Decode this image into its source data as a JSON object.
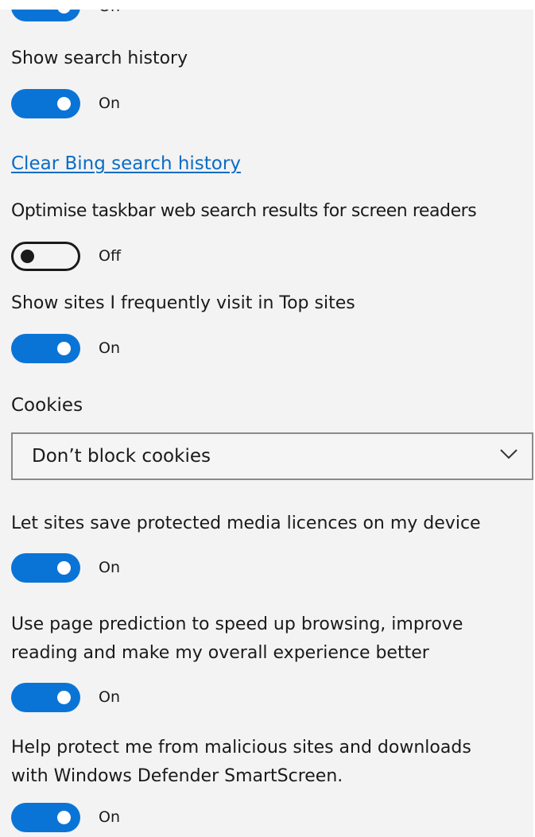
{
  "settings": {
    "top_partial_state": "On",
    "search_history": {
      "label": "Show search history",
      "state": "On",
      "enabled": true
    },
    "clear_bing_link": "Clear Bing search history",
    "taskbar_screen_readers": {
      "label": "Optimise taskbar web search results for screen readers",
      "state": "Off",
      "enabled": false
    },
    "top_sites": {
      "label": "Show sites I frequently visit in Top sites",
      "state": "On",
      "enabled": true
    },
    "cookies": {
      "label": "Cookies",
      "selected": "Don’t block cookies"
    },
    "media_licences": {
      "label": "Let sites save protected media licences on my device",
      "state": "On",
      "enabled": true
    },
    "page_prediction": {
      "label_line1": "Use page prediction to speed up browsing, improve",
      "label_line2": "reading and make my overall experience better",
      "state": "On",
      "enabled": true
    },
    "smartscreen": {
      "label_line1": "Help protect me from malicious sites and downloads",
      "label_line2": "with Windows Defender SmartScreen.",
      "state": "On",
      "enabled": true
    }
  },
  "icons": {
    "dropdown": "chevron-down-icon"
  },
  "colors": {
    "toggle_on": "#0a74d6",
    "link": "#0b6cc4",
    "panel_background": "#f3f3f3"
  }
}
